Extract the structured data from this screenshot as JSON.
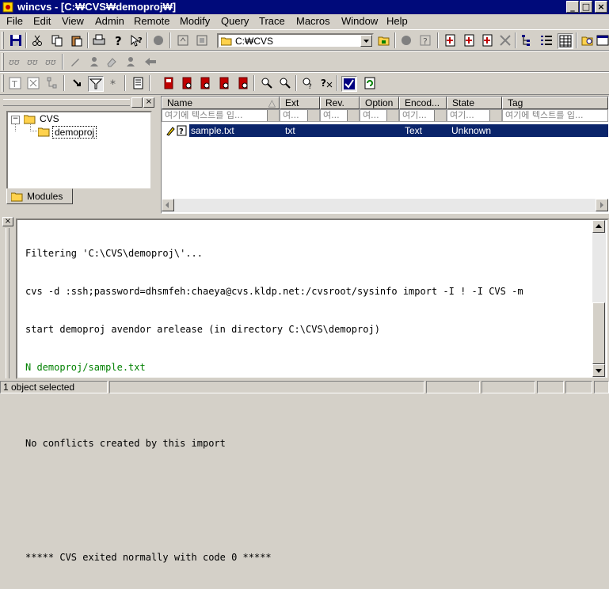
{
  "window": {
    "title": "wincvs - [C:₩CVS₩demoproj₩]"
  },
  "menu": [
    "File",
    "Edit",
    "View",
    "Admin",
    "Remote",
    "Modify",
    "Query",
    "Trace",
    "Macros",
    "Window",
    "Help"
  ],
  "toolbar": {
    "path_value": "C:₩CVS"
  },
  "tree": {
    "root": "CVS",
    "child": "demoproj",
    "tab": "Modules"
  },
  "file_list": {
    "columns": [
      "Name",
      "Ext",
      "Rev.",
      "Option",
      "Encod...",
      "State",
      "Tag"
    ],
    "filters": [
      "여기에 텍스트를 입...",
      "여...",
      "여...",
      "여...",
      "여기...",
      "여기...",
      "여기에 텍스트를 입..."
    ],
    "rows": [
      {
        "name": "sample.txt",
        "ext": "txt",
        "rev": "",
        "option": "",
        "encoding": "Text",
        "state": "Unknown",
        "tag": ""
      }
    ]
  },
  "output": {
    "lines": [
      "Filtering 'C:\\CVS\\demoproj\\'...",
      "cvs -d :ssh;password=dhsmfeh:chaeya@cvs.kldp.net:/cvsroot/sysinfo import -I ! -I CVS -m",
      "start demoproj avendor arelease (in directory C:\\CVS\\demoproj)",
      "N demoproj/sample.txt",
      "",
      "No conflicts created by this import",
      "",
      "",
      "***** CVS exited normally with code 0 *****"
    ],
    "green_line_index": 3
  },
  "status": {
    "text": "1 object selected"
  },
  "colors": {
    "titlebar": "#000a7a",
    "selection": "#0a246a",
    "green_text": "#008000"
  }
}
